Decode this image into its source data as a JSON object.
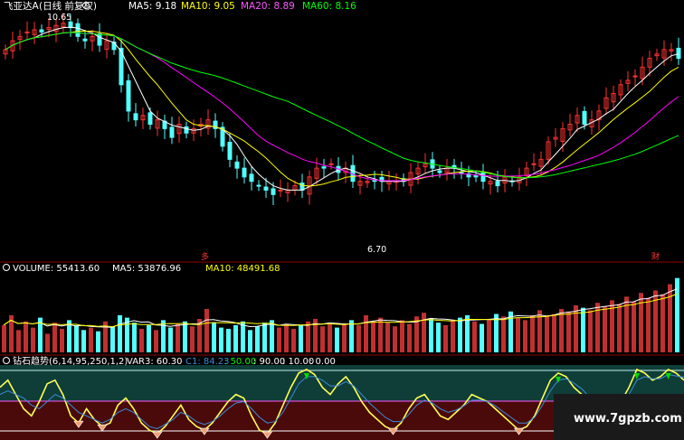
{
  "main_panel": {
    "stock_title": "飞亚达A",
    "period_label": "(日线 前复权)",
    "ma_legend": [
      {
        "label": "MA5: 9.18",
        "color": "#ffffff"
      },
      {
        "label": "MA10: 9.05",
        "color": "#ffff00"
      },
      {
        "label": "MA20: 8.89",
        "color": "#ff00ff"
      },
      {
        "label": "MA60: 8.16",
        "color": "#00ff00"
      }
    ],
    "high_price_label": "10.65",
    "low_price_label": "6.70",
    "left_marker": "多",
    "right_marker": "财"
  },
  "volume_panel": {
    "legend": [
      {
        "label": "VOLUME: 55413.60",
        "color": "#ffffff"
      },
      {
        "label": "MA5: 53876.96",
        "color": "#ffffff"
      },
      {
        "label": "MA10: 48491.68",
        "color": "#ffff00"
      }
    ]
  },
  "indicator_panel": {
    "legend": [
      {
        "label": "钻石趋势(6,14,95,250,1,2)",
        "color": "#ffffff"
      },
      {
        "label": "VAR3: 60.30",
        "color": "#ffffff"
      },
      {
        "label": "C1: 84.23",
        "color": "#3b8bd8"
      },
      {
        "label": ": 50.00",
        "color": "#00ff00"
      },
      {
        "label": ": 90.00",
        "color": "#ffffff"
      },
      {
        "label": ": 10.00",
        "color": "#ffffff"
      },
      {
        "label": ": 0.00",
        "color": "#ffffff"
      }
    ]
  },
  "watermark": "www.7gpzb.com",
  "colors": {
    "up": "#ff3232",
    "down": "#54ffff",
    "ma5": "#ffffff",
    "ma10": "#ffff00",
    "ma20": "#ff00ff",
    "ma60": "#00ff00",
    "var3": "#ffff55",
    "c1": "#3b8bd8"
  },
  "chart_data": [
    {
      "type": "candlestick",
      "title": "飞亚达A (日线 前复权)",
      "ylim": [
        6.7,
        10.65
      ],
      "series": [
        {
          "name": "close",
          "x": [
            0,
            8,
            16,
            24,
            32,
            40,
            48,
            56,
            64,
            72,
            80,
            88,
            96,
            104,
            112,
            120,
            128,
            136,
            144,
            152,
            160,
            168,
            176,
            184,
            192,
            200,
            208,
            216,
            224,
            232,
            240,
            248,
            256,
            264,
            272,
            280,
            288,
            296,
            304,
            312,
            320,
            328,
            336,
            344,
            352,
            360,
            368,
            376,
            384,
            392,
            400,
            408,
            416,
            424,
            432,
            440,
            448,
            456,
            464,
            472,
            480,
            488,
            496,
            504,
            512,
            520,
            528,
            536,
            544,
            552,
            560,
            568,
            576,
            584,
            592,
            600,
            608,
            616,
            624,
            632,
            640,
            648,
            656,
            664,
            672,
            680,
            688,
            696,
            704,
            712,
            720,
            728,
            736,
            744
          ],
          "values": [
            10.0,
            10.2,
            10.3,
            10.4,
            10.45,
            10.4,
            10.5,
            10.55,
            10.6,
            10.5,
            10.3,
            10.2,
            10.3,
            10.1,
            10.2,
            10.0,
            9.2,
            8.6,
            8.4,
            8.5,
            8.3,
            8.4,
            8.2,
            8.0,
            8.3,
            8.1,
            8.2,
            8.3,
            8.4,
            8.2,
            7.8,
            7.5,
            7.3,
            7.1,
            7.0,
            6.9,
            6.8,
            6.7,
            6.8,
            6.8,
            6.9,
            6.8,
            7.1,
            7.3,
            7.3,
            7.4,
            7.2,
            7.3,
            7.0,
            7.0,
            7.0,
            7.0,
            7.0,
            7.0,
            7.0,
            7.0,
            7.2,
            7.3,
            7.4,
            7.3,
            7.2,
            7.3,
            7.3,
            7.2,
            7.1,
            7.1,
            7.0,
            7.0,
            6.9,
            7.1,
            7.0,
            7.1,
            7.3,
            7.4,
            7.5,
            7.9,
            8.0,
            8.2,
            8.3,
            8.5,
            8.3,
            8.4,
            8.6,
            8.9,
            9.0,
            9.2,
            9.3,
            9.4,
            9.6,
            9.8,
            9.9,
            10.0,
            10.0,
            9.8
          ]
        },
        {
          "name": "MA5",
          "values": "see line"
        },
        {
          "name": "MA10",
          "values": "see line"
        },
        {
          "name": "MA20",
          "values": "see line"
        },
        {
          "name": "MA60",
          "values": "see line"
        }
      ]
    },
    {
      "type": "bar",
      "title": "VOLUME",
      "values": [
        22,
        30,
        18,
        25,
        20,
        28,
        15,
        24,
        19,
        26,
        22,
        18,
        20,
        17,
        25,
        21,
        30,
        28,
        24,
        19,
        22,
        18,
        26,
        20,
        23,
        25,
        21,
        27,
        35,
        24,
        20,
        19,
        22,
        25,
        18,
        21,
        24,
        26,
        20,
        23,
        19,
        22,
        25,
        27,
        21,
        24,
        20,
        23,
        26,
        22,
        30,
        25,
        28,
        24,
        21,
        26,
        23,
        29,
        32,
        27,
        24,
        22,
        26,
        28,
        30,
        25,
        23,
        27,
        31,
        29,
        33,
        28,
        26,
        30,
        34,
        29,
        31,
        35,
        33,
        38,
        36,
        34,
        40,
        37,
        42,
        39,
        45,
        41,
        48,
        44,
        50,
        47,
        55,
        60
      ]
    },
    {
      "type": "line",
      "title": "钻石趋势(6,14,95,250,1,2)",
      "ylim": [
        0,
        100
      ],
      "series": [
        {
          "name": "VAR3",
          "values": [
            70,
            80,
            60,
            40,
            30,
            50,
            75,
            80,
            60,
            30,
            20,
            40,
            25,
            15,
            20,
            45,
            55,
            40,
            20,
            10,
            5,
            15,
            30,
            45,
            25,
            15,
            10,
            20,
            35,
            50,
            60,
            55,
            30,
            10,
            5,
            20,
            45,
            70,
            90,
            95,
            88,
            70,
            60,
            75,
            85,
            70,
            50,
            35,
            25,
            15,
            10,
            20,
            40,
            55,
            60,
            45,
            30,
            25,
            35,
            45,
            60,
            55,
            50,
            40,
            30,
            20,
            10,
            15,
            30,
            55,
            80,
            90,
            85,
            70,
            60,
            45,
            35,
            20,
            30,
            50,
            70,
            95,
            90,
            80,
            85,
            95,
            90,
            80
          ]
        },
        {
          "name": "C1",
          "values": [
            60,
            65,
            60,
            55,
            45,
            40,
            50,
            60,
            55,
            45,
            35,
            30,
            25,
            20,
            25,
            35,
            40,
            35,
            25,
            15,
            12,
            18,
            25,
            35,
            30,
            22,
            18,
            22,
            30,
            40,
            48,
            50,
            40,
            28,
            20,
            22,
            35,
            55,
            75,
            85,
            85,
            80,
            72,
            72,
            78,
            72,
            60,
            48,
            38,
            28,
            22,
            22,
            32,
            45,
            52,
            48,
            40,
            35,
            38,
            44,
            52,
            52,
            50,
            44,
            36,
            28,
            20,
            20,
            28,
            45,
            65,
            80,
            82,
            76,
            68,
            56,
            46,
            34,
            34,
            44,
            60,
            80,
            85,
            82,
            82,
            88,
            86,
            84
          ]
        }
      ]
    }
  ]
}
